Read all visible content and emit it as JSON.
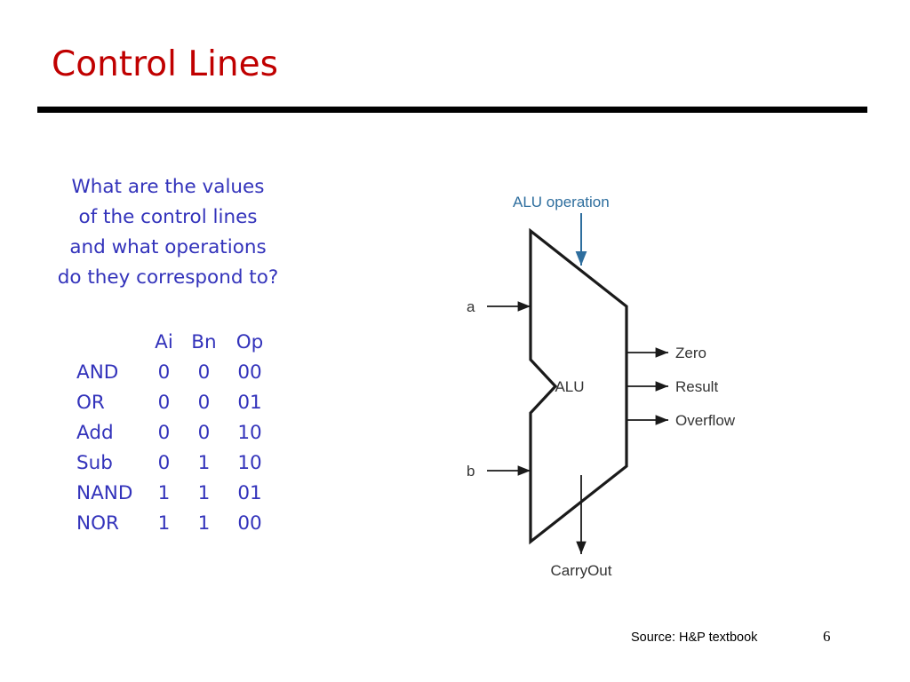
{
  "slide": {
    "title": "Control Lines",
    "title_color": "#C00000",
    "accent_blue": "#3333BB",
    "diagram_blue": "#2E6E9E"
  },
  "question": {
    "line1": "What are the values",
    "line2": "of the control lines",
    "line3": "and what operations",
    "line4": "do they correspond to?"
  },
  "table": {
    "headers": [
      "",
      "Ai",
      "Bn",
      "Op"
    ],
    "rows": [
      {
        "op": "AND",
        "ai": "0",
        "bn": "0",
        "opcode": "00"
      },
      {
        "op": "OR",
        "ai": "0",
        "bn": "0",
        "opcode": "01"
      },
      {
        "op": "Add",
        "ai": "0",
        "bn": "0",
        "opcode": "10"
      },
      {
        "op": "Sub",
        "ai": "0",
        "bn": "1",
        "opcode": "10"
      },
      {
        "op": "NAND",
        "ai": "1",
        "bn": "1",
        "opcode": "01"
      },
      {
        "op": "NOR",
        "ai": "1",
        "bn": "1",
        "opcode": "00"
      }
    ]
  },
  "diagram": {
    "control_label": "ALU operation",
    "block_label": "ALU",
    "input_a": "a",
    "input_b": "b",
    "output_zero": "Zero",
    "output_result": "Result",
    "output_overflow": "Overflow",
    "output_carryout": "CarryOut"
  },
  "footer": {
    "source": "Source: H&P textbook",
    "page": "6"
  }
}
